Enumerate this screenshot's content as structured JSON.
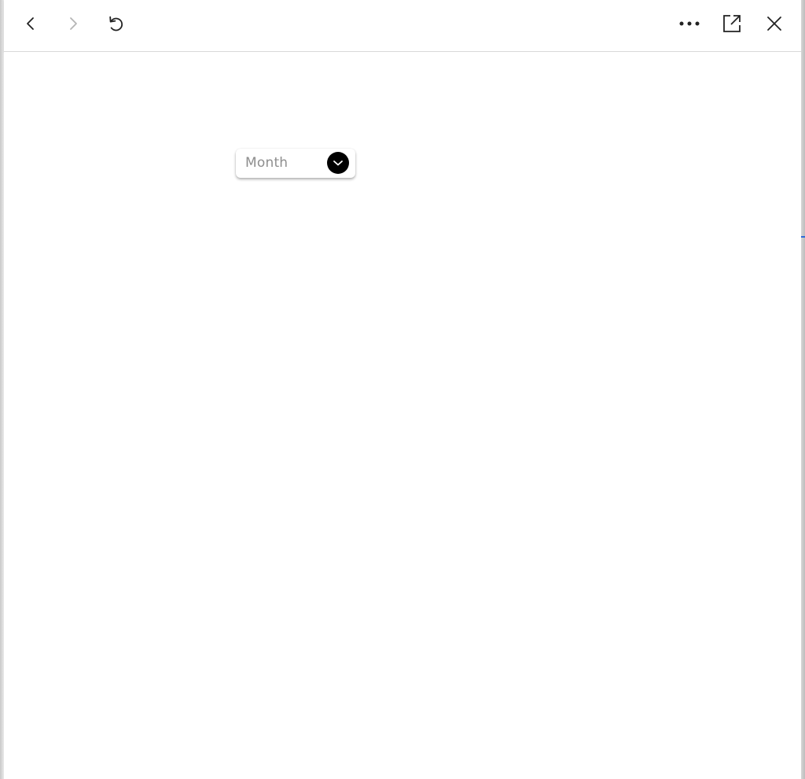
{
  "toolbar": {
    "buttons": [
      {
        "icon": "chevron-left-icon",
        "enabled": true
      },
      {
        "icon": "chevron-right-icon",
        "enabled": false
      },
      {
        "icon": "refresh-icon",
        "enabled": true
      },
      {
        "icon": "more-icon",
        "enabled": true
      },
      {
        "icon": "open-external-icon",
        "enabled": true
      },
      {
        "icon": "close-icon",
        "enabled": true
      }
    ]
  },
  "content": {
    "month_dropdown": {
      "label": "Month",
      "icon": "chevron-down-icon"
    }
  },
  "colors": {
    "icon_active": "#222222",
    "icon_disabled": "#b5b5b5",
    "dropdown_text": "#8e8e8e",
    "dropdown_chevron_bg": "#000000",
    "accent": "#2f6ad8"
  }
}
